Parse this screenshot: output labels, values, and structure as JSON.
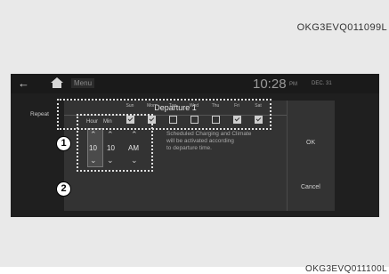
{
  "codes": {
    "top": "OKG3EVQ011099L",
    "bottom": "OKG3EVQ011100L"
  },
  "topbar": {
    "menu_label": "Menu",
    "time": "10:28",
    "ampm": "PM",
    "date": "DEC. 31"
  },
  "dialog": {
    "title": "Departure 1",
    "description": [
      "Scheduled Charging and Climate",
      "will be activated according",
      "to departure time."
    ],
    "ok_label": "OK",
    "cancel_label": "Cancel"
  },
  "time": {
    "hour_label": "Hour",
    "min_label": "Min",
    "hour": "10",
    "minute": "10",
    "ampm": "AM"
  },
  "repeat": {
    "label": "Repeat",
    "days": [
      {
        "label": "Sun",
        "checked": true
      },
      {
        "label": "Mon",
        "checked": true
      },
      {
        "label": "Tue",
        "checked": false
      },
      {
        "label": "Wed",
        "checked": false
      },
      {
        "label": "Thu",
        "checked": false
      },
      {
        "label": "Fri",
        "checked": true
      },
      {
        "label": "Sat",
        "checked": true
      }
    ]
  },
  "callouts": {
    "one": "1",
    "two": "2"
  },
  "icons": {
    "back": "back-arrow-icon",
    "home": "home-icon",
    "up": "chevron-up-icon",
    "down": "chevron-down-icon"
  }
}
